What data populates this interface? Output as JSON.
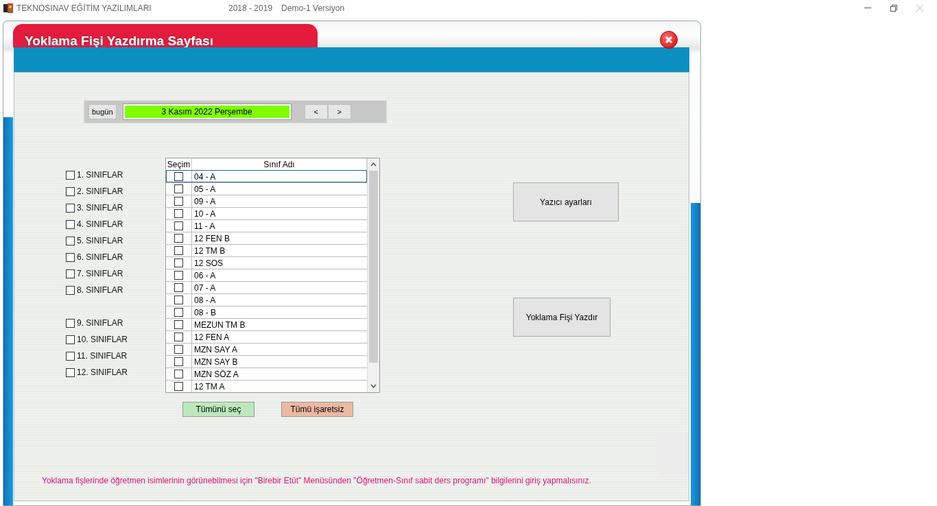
{
  "app_bar": {
    "title": "TEKNOSINAV EĞİTİM YAZILIMLARI",
    "years": "2018 - 2019",
    "version": "Demo-1 Versiyon"
  },
  "dialog": {
    "title": "Yoklama Fişi Yazdırma Sayfası"
  },
  "date_bar": {
    "today_button": "bugün",
    "date": "3 Kasım 2022 Perşembe",
    "nav_buttons": [
      "<",
      ">"
    ]
  },
  "grade_groups": [
    [
      {
        "label": "1. SINIFLAR",
        "checked": false
      },
      {
        "label": "2. SINIFLAR",
        "checked": false
      },
      {
        "label": "3. SINIFLAR",
        "checked": false
      },
      {
        "label": "4. SINIFLAR",
        "checked": false
      },
      {
        "label": "5. SINIFLAR",
        "checked": false
      },
      {
        "label": "6. SINIFLAR",
        "checked": false
      },
      {
        "label": "7. SINIFLAR",
        "checked": false
      },
      {
        "label": "8. SINIFLAR",
        "checked": false
      }
    ],
    [
      {
        "label": "9. SINIFLAR",
        "checked": false
      },
      {
        "label": "10. SINIFLAR",
        "checked": false
      },
      {
        "label": "11. SINIFLAR",
        "checked": false
      },
      {
        "label": "12. SINIFLAR",
        "checked": false
      }
    ]
  ],
  "table": {
    "columns": [
      "Seçim",
      "Sınıf Adı"
    ],
    "rows": [
      {
        "name": "04 - A",
        "checked": false,
        "selected": true
      },
      {
        "name": "05 - A",
        "checked": false,
        "selected": false
      },
      {
        "name": "09 - A",
        "checked": false,
        "selected": false
      },
      {
        "name": "10 - A",
        "checked": false,
        "selected": false
      },
      {
        "name": "11 - A",
        "checked": false,
        "selected": false
      },
      {
        "name": "12 FEN B",
        "checked": false,
        "selected": false
      },
      {
        "name": "12 TM B",
        "checked": false,
        "selected": false
      },
      {
        "name": "12 SOS",
        "checked": false,
        "selected": false
      },
      {
        "name": "06 - A",
        "checked": false,
        "selected": false
      },
      {
        "name": "07 - A",
        "checked": false,
        "selected": false
      },
      {
        "name": "08 - A",
        "checked": false,
        "selected": false
      },
      {
        "name": "08 - B",
        "checked": false,
        "selected": false
      },
      {
        "name": "MEZUN TM B",
        "checked": false,
        "selected": false
      },
      {
        "name": "12 FEN A",
        "checked": false,
        "selected": false
      },
      {
        "name": "MZN SAY A",
        "checked": false,
        "selected": false
      },
      {
        "name": "MZN SAY B",
        "checked": false,
        "selected": false
      },
      {
        "name": "MZN SÖZ A",
        "checked": false,
        "selected": false
      },
      {
        "name": "12 TM A",
        "checked": false,
        "selected": false
      }
    ]
  },
  "select_all_button": "Tümünü seç",
  "clear_all_button": "Tümü işaretsiz",
  "printer_settings_button": "Yazıcı ayarları",
  "print_button": "Yoklama Fişi Yazdır",
  "notice": "Yoklama fişlerinde öğretmen isimlerinin görünebilmesi için \"Birebir Etüt\" Menüsünden \"Öğretmen-Sınıf sabit ders programı\" bilgilerini giriş yapmalısınız."
}
